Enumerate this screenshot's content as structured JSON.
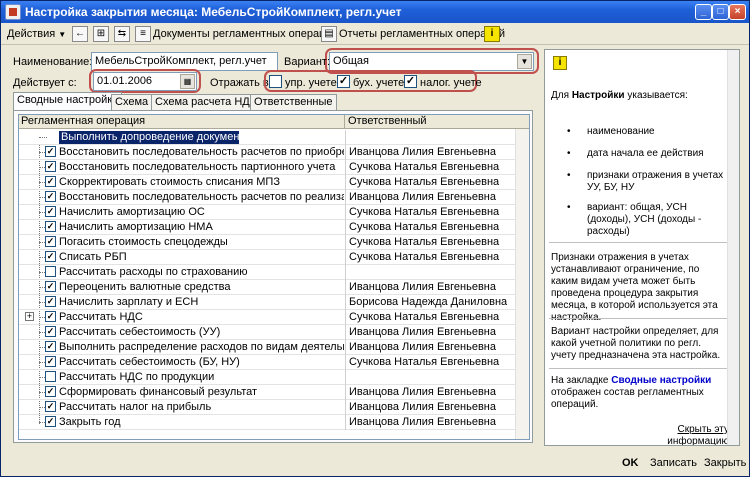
{
  "window": {
    "title": "Настройка закрытия месяца: МебельСтройКомплект, регл.учет"
  },
  "toolbar": {
    "actions_label": "Действия",
    "documents_label": "Документы регламентных операций",
    "reports_label": "Отчеты регламентных операций"
  },
  "form": {
    "name_label": "Наименование:",
    "name_value": "МебельСтройКомплект, регл.учет",
    "variant_label": "Вариант:",
    "variant_value": "Общая",
    "valid_from_label": "Действует с:",
    "valid_from_value": "01.01.2006",
    "reflect_label": "Отражать в:",
    "reflect_options": [
      {
        "label": "упр. учете",
        "checked": false
      },
      {
        "label": "бух. учете",
        "checked": true
      },
      {
        "label": "налог. учете",
        "checked": true
      }
    ]
  },
  "tabs": [
    {
      "label": "Сводные настройки",
      "active": true
    },
    {
      "label": "Схема",
      "active": false
    },
    {
      "label": "Схема расчета НДС",
      "active": false
    },
    {
      "label": "Ответственные",
      "active": false
    }
  ],
  "table": {
    "columns": [
      "Регламентная операция",
      "Ответственный"
    ],
    "rows": [
      {
        "operation": "Выполнить допроведение документов",
        "responsible": "",
        "checked": false
      },
      {
        "operation": "Восстановить последовательность расчетов по приобретению",
        "responsible": "Иванцова Лилия Евгеньевна",
        "checked": true
      },
      {
        "operation": "Восстановить последовательность партионного учета",
        "responsible": "Сучкова Наталья Евгеньевна",
        "checked": true
      },
      {
        "operation": "Скорректировать стоимость списания МПЗ",
        "responsible": "Сучкова Наталья Евгеньевна",
        "checked": true
      },
      {
        "operation": "Восстановить последовательность расчетов по реализации",
        "responsible": "Иванцова Лилия Евгеньевна",
        "checked": true
      },
      {
        "operation": "Начислить амортизацию ОС",
        "responsible": "Сучкова Наталья Евгеньевна",
        "checked": true
      },
      {
        "operation": "Начислить амортизацию НМА",
        "responsible": "Сучкова Наталья Евгеньевна",
        "checked": true
      },
      {
        "operation": "Погасить стоимость спецодежды",
        "responsible": "Сучкова Наталья Евгеньевна",
        "checked": true
      },
      {
        "operation": "Списать РБП",
        "responsible": "Сучкова Наталья Евгеньевна",
        "checked": true
      },
      {
        "operation": "Рассчитать расходы по страхованию",
        "responsible": "",
        "checked": false
      },
      {
        "operation": "Переоценить валютные средства",
        "responsible": "Иванцова Лилия Евгеньевна",
        "checked": true
      },
      {
        "operation": "Начислить зарплату и ЕСН",
        "responsible": "Борисова Надежда Даниловна",
        "checked": true
      },
      {
        "operation": "Рассчитать НДС",
        "responsible": "Сучкова Наталья Евгеньевна",
        "checked": true
      },
      {
        "operation": "Рассчитать себестоимость (УУ)",
        "responsible": "Иванцова Лилия Евгеньевна",
        "checked": true
      },
      {
        "operation": "Выполнить распределение расходов по видам деятельности, н...",
        "responsible": "Иванцова Лилия Евгеньевна",
        "checked": true
      },
      {
        "operation": "Рассчитать себестоимость (БУ, НУ)",
        "responsible": "Сучкова Наталья Евгеньевна",
        "checked": true
      },
      {
        "operation": "Рассчитать НДС по продукции",
        "responsible": "",
        "checked": false
      },
      {
        "operation": "Сформировать финансовый результат",
        "responsible": "Иванцова Лилия Евгеньевна",
        "checked": true
      },
      {
        "operation": "Рассчитать налог на прибыль",
        "responsible": "Иванцова Лилия Евгеньевна",
        "checked": true
      },
      {
        "operation": "Закрыть год",
        "responsible": "Иванцова Лилия Евгеньевна",
        "checked": true
      }
    ]
  },
  "help": {
    "intro_prefix": "Для ",
    "intro_bold": "Настройки",
    "intro_suffix": " указывается:",
    "bullets": [
      "наименование",
      "дата начала ее действия",
      "признаки отражения в учетах УУ, БУ, НУ",
      "вариант: общая, УСН (доходы), УСН (доходы - расходы)"
    ],
    "para1": "Признаки отражения в учетах устанавливают ограничение, по каким видам учета может быть проведена процедура закрытия месяца, в которой используется эта настройка.",
    "para2": "Вариант настройки определяет, для какой учетной политики по регл. учету предназначена эта настройка.",
    "para3_prefix": "На закладке ",
    "para3_link": "Сводные настройки",
    "para3_suffix": " отображен состав регламентных операций.",
    "hide_link": "Скрыть эту информацию"
  },
  "buttons": {
    "ok": "OK",
    "save": "Записать",
    "close": "Закрыть"
  },
  "colors": {
    "accent_red": "#c0504d",
    "selection": "#0a246a",
    "link": "#0000cc"
  }
}
